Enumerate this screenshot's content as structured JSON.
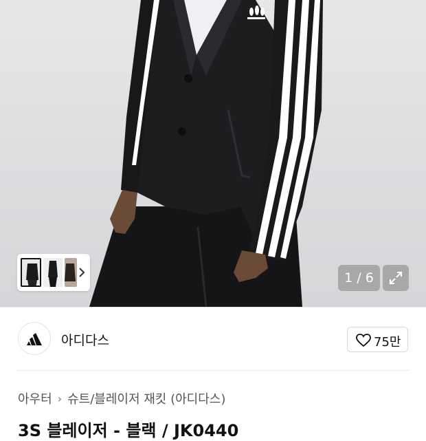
{
  "gallery": {
    "counter": "1 / 6",
    "thumbnails": [
      "thumbnail-1",
      "thumbnail-2",
      "thumbnail-3"
    ]
  },
  "brand": {
    "name": "아디다스",
    "like_count": "75만"
  },
  "breadcrumb": {
    "level1": "아우터",
    "level2": "슈트/블레이저 재킷 (아디다스)"
  },
  "product": {
    "title": "3S 블레이저 - 블랙 / JK0440"
  },
  "icons": {
    "brand_logo": "adidas-logo",
    "like": "heart-icon",
    "expand": "expand-icon",
    "chevron": "chevron-right-icon"
  },
  "colors": {
    "jacket": "#1c1c1e",
    "stripe": "#ffffff",
    "background": "#e0e0e3"
  }
}
